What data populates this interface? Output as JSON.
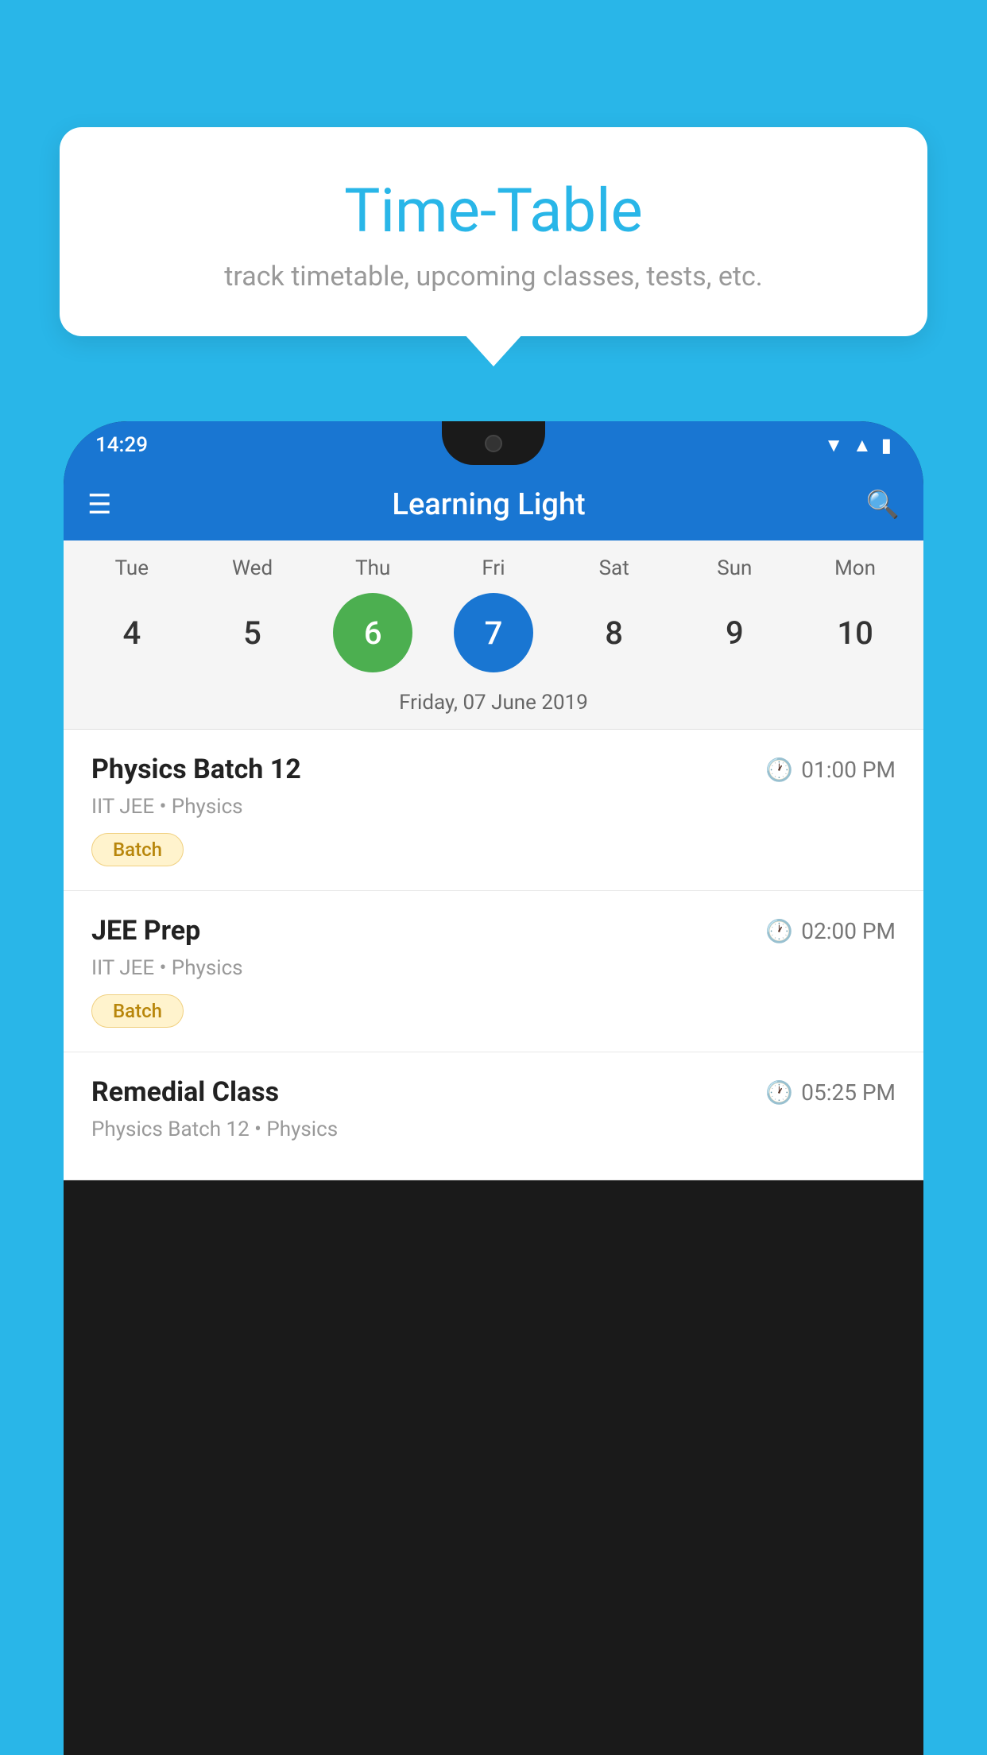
{
  "background_color": "#29B6E8",
  "tooltip": {
    "title": "Time-Table",
    "subtitle": "track timetable, upcoming classes, tests, etc."
  },
  "phone": {
    "status_bar": {
      "time": "14:29"
    },
    "app_bar": {
      "title": "Learning Light"
    },
    "calendar": {
      "days": [
        "Tue",
        "Wed",
        "Thu",
        "Fri",
        "Sat",
        "Sun",
        "Mon"
      ],
      "dates": [
        {
          "num": "4",
          "state": "normal"
        },
        {
          "num": "5",
          "state": "normal"
        },
        {
          "num": "6",
          "state": "today"
        },
        {
          "num": "7",
          "state": "selected"
        },
        {
          "num": "8",
          "state": "normal"
        },
        {
          "num": "9",
          "state": "normal"
        },
        {
          "num": "10",
          "state": "normal"
        }
      ],
      "selected_date_label": "Friday, 07 June 2019"
    },
    "schedule": [
      {
        "title": "Physics Batch 12",
        "time": "01:00 PM",
        "subtitle": "IIT JEE • Physics",
        "tag": "Batch"
      },
      {
        "title": "JEE Prep",
        "time": "02:00 PM",
        "subtitle": "IIT JEE • Physics",
        "tag": "Batch"
      },
      {
        "title": "Remedial Class",
        "time": "05:25 PM",
        "subtitle": "Physics Batch 12 • Physics",
        "tag": null
      }
    ]
  }
}
